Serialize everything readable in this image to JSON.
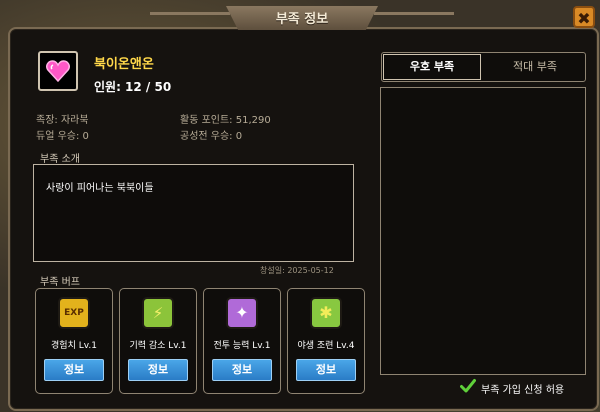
{
  "window": {
    "title": "부족 정보"
  },
  "guild": {
    "name": "북이온앤온",
    "members_label": "인원: 12 / 50",
    "leader_label": "족장: 자라북",
    "points_label": "활동 포인트: 51,290",
    "duel_label": "듀얼 우승: 0",
    "siege_label": "공성전 우승: 0"
  },
  "intro": {
    "title": "부족 소개",
    "text": "사랑이 피어나는 북북이들",
    "date": "창설일: 2025-05-12"
  },
  "buffs": {
    "title": "부족 버프",
    "items": [
      {
        "icon_text": "EXP",
        "icon": "exp-icon",
        "label": "경험치 Lv.1",
        "button": "정보",
        "color": "#e3b21c"
      },
      {
        "icon_text": "⚡",
        "icon": "lightning-icon",
        "label": "기력 감소 Lv.1",
        "button": "정보",
        "color": "#8cc43a"
      },
      {
        "icon_text": "✦",
        "icon": "sparkle-icon",
        "label": "전투 능력 Lv.1",
        "button": "정보",
        "color": "#b06ad8"
      },
      {
        "icon_text": "✱",
        "icon": "arrow-burst-icon",
        "label": "야생 조련 Lv.4",
        "button": "정보",
        "color": "#88c840"
      }
    ]
  },
  "relations": {
    "tabs": [
      "우호 부족",
      "적대 부족"
    ],
    "active_tab": 0
  },
  "join": {
    "label": "부족 가입 신청 허용",
    "checked": true,
    "check_color": "#5fd03a"
  }
}
